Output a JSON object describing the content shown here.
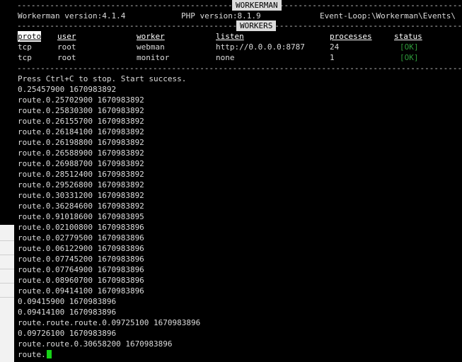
{
  "header": {
    "title_banner": "WORKERMAN",
    "workerman_version": "Workerman version:4.1.4",
    "php_version": "PHP version:8.1.9",
    "event_loop": "Event-Loop:\\Workerman\\Events\\"
  },
  "workers": {
    "banner": "WORKERS",
    "columns": [
      "proto",
      "user",
      "worker",
      "listen",
      "processes",
      "status"
    ],
    "rows": [
      [
        "tcp",
        "root",
        "webman",
        "http://0.0.0.0:8787",
        "24",
        "[OK]"
      ],
      [
        "tcp",
        "root",
        "monitor",
        "none",
        "1",
        "[OK]"
      ]
    ]
  },
  "status_message": "Press Ctrl+C to stop. Start success.",
  "log_lines": [
    "0.25457900 1670983892",
    "route.0.25702900 1670983892",
    "route.0.25830300 1670983892",
    "route.0.26155700 1670983892",
    "route.0.26184100 1670983892",
    "route.0.26198800 1670983892",
    "route.0.26588900 1670983892",
    "route.0.26988700 1670983892",
    "route.0.28512400 1670983892",
    "route.0.29526800 1670983892",
    "route.0.30331200 1670983892",
    "route.0.36284600 1670983892",
    "route.0.91018600 1670983895",
    "route.0.02100800 1670983896",
    "route.0.02779500 1670983896",
    "route.0.06122900 1670983896",
    "route.0.07745200 1670983896",
    "route.0.07764900 1670983896",
    "route.0.08960700 1670983896",
    "route.0.09414100 1670983896",
    "0.09415900 1670983896",
    "0.09414100 1670983896",
    "route.route.route.0.09725100 1670983896",
    "0.09726100 1670983896",
    "route.route.0.30658200 1670983896"
  ],
  "prompt_line": "route.",
  "colors": {
    "ok": "#2e9a3a",
    "cursor": "#17d317",
    "background": "#000000"
  }
}
